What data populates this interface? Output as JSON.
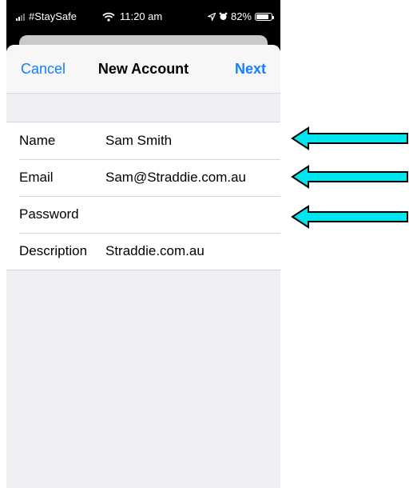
{
  "status_bar": {
    "carrier": "#StaySafe",
    "time": "11:20 am",
    "battery_percent": "82%",
    "battery_level": 0.82
  },
  "nav": {
    "cancel": "Cancel",
    "title": "New Account",
    "next": "Next"
  },
  "form": {
    "rows": [
      {
        "label": "Name",
        "value": "Sam Smith"
      },
      {
        "label": "Email",
        "value": "Sam@Straddie.com.au"
      },
      {
        "label": "Password",
        "value": ""
      },
      {
        "label": "Description",
        "value": "Straddie.com.au"
      }
    ]
  },
  "annotations": {
    "arrow_color": "#00e5ee",
    "arrow_targets": [
      "Name",
      "Email",
      "Password"
    ]
  },
  "colors": {
    "accent": "#147efb",
    "sheet_background": "#efeff4"
  },
  "icons": [
    "signal-bars-icon",
    "wifi-icon",
    "location-arrow-icon",
    "alarm-clock-icon",
    "battery-icon"
  ]
}
